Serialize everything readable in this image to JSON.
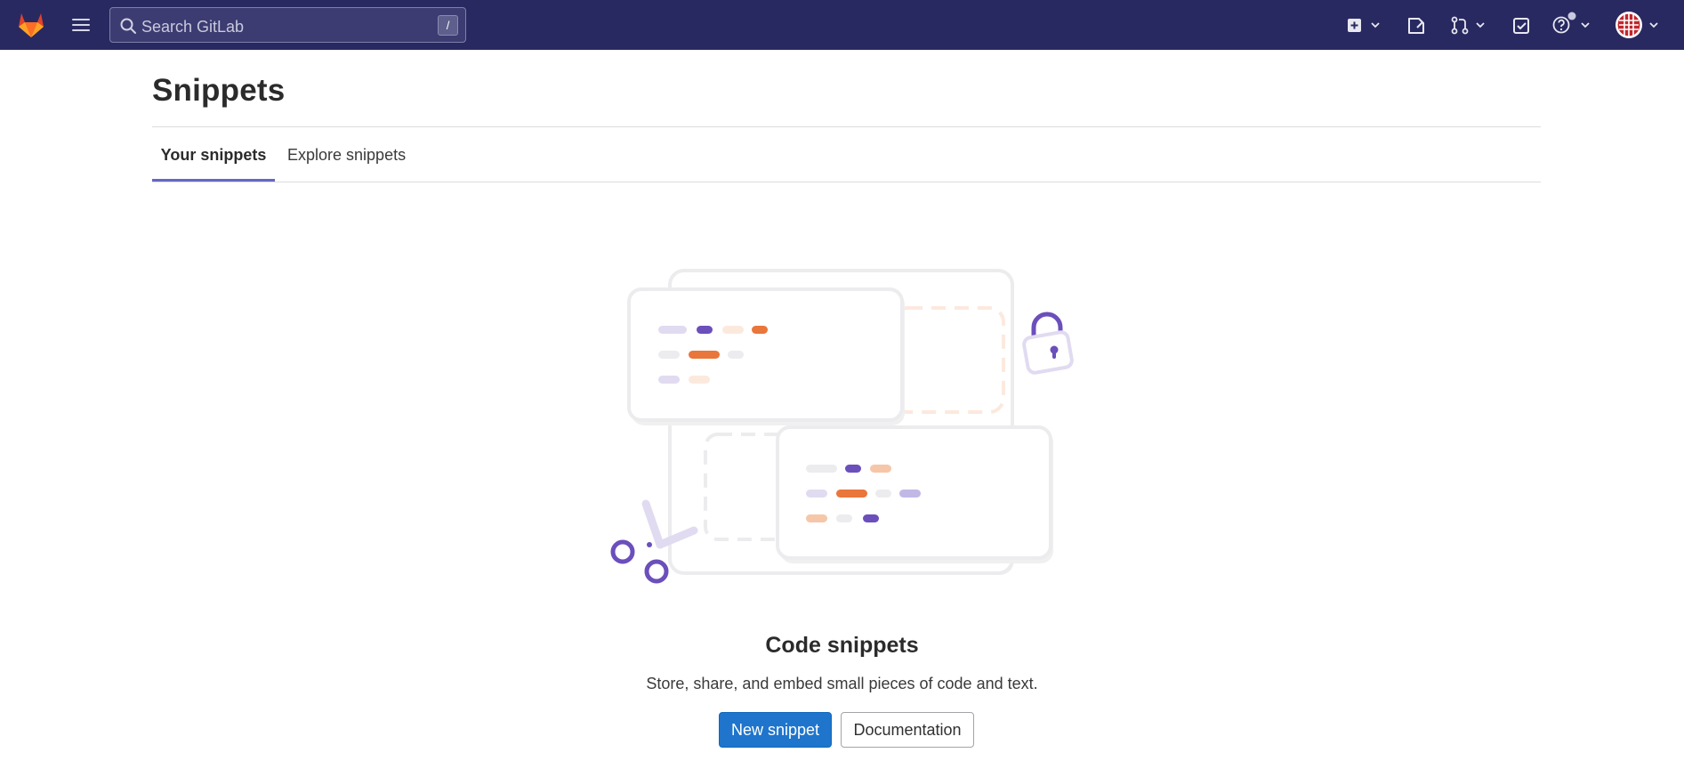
{
  "header": {
    "logo_icon": "gitlab-tanuki-icon",
    "menu_icon": "hamburger-menu-icon",
    "search": {
      "placeholder": "Search GitLab",
      "shortcut": "/"
    },
    "actions": [
      {
        "icon": "new-item-plus-icon",
        "has_dropdown": true
      },
      {
        "icon": "issues-icon",
        "has_dropdown": false
      },
      {
        "icon": "merge-requests-icon",
        "has_dropdown": true
      },
      {
        "icon": "todos-check-icon",
        "has_dropdown": false
      },
      {
        "icon": "help-question-icon",
        "has_dropdown": true
      },
      {
        "icon": "user-avatar",
        "has_dropdown": true
      }
    ]
  },
  "page": {
    "title": "Snippets",
    "tabs": [
      {
        "label": "Your snippets",
        "active": true
      },
      {
        "label": "Explore snippets",
        "active": false
      }
    ]
  },
  "empty_state": {
    "illustration": "code-snippets-illustration",
    "title": "Code snippets",
    "description": "Store, share, and embed small pieces of code and text.",
    "primary_button": "New snippet",
    "secondary_button": "Documentation"
  },
  "colors": {
    "header_bg": "#292961",
    "primary_button": "#1f75cb",
    "tab_active_underline": "#6666c4",
    "illustration_purple": "#6b4fbb",
    "illustration_orange": "#e9763a"
  }
}
